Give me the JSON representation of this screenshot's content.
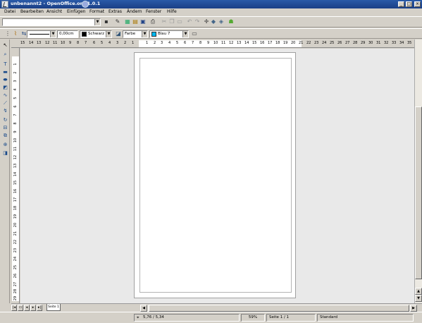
{
  "window": {
    "title": "unbenannt2 - OpenOffice.org 1.0.1",
    "controls": [
      "_",
      "□",
      "×"
    ]
  },
  "menu": [
    "Datei",
    "Bearbeiten",
    "Ansicht",
    "Einfügen",
    "Format",
    "Extras",
    "Ändern",
    "Fenster",
    "Hilfe"
  ],
  "toolbar1": {
    "url_value": ""
  },
  "toolbar2": {
    "line_style": "",
    "line_width": "0,00cm",
    "line_color": "Schwarz",
    "line_color_hex": "#000000",
    "area_style": "Farbe",
    "area_color": "Blau 7",
    "area_color_hex": "#00b8f0"
  },
  "ruler_h": {
    "left": [
      "15",
      "14",
      "13",
      "12",
      "11",
      "10",
      "9",
      "8",
      "7",
      "6",
      "5",
      "4",
      "3",
      "2",
      "1"
    ],
    "right": [
      "1",
      "2",
      "3",
      "4",
      "5",
      "6",
      "7",
      "8",
      "9",
      "10",
      "11",
      "12",
      "13",
      "14",
      "15",
      "16",
      "17",
      "18",
      "19",
      "20",
      "21",
      "22",
      "23",
      "24",
      "25",
      "26",
      "27",
      "28",
      "29",
      "30",
      "31",
      "32",
      "33",
      "34",
      "35"
    ]
  },
  "ruler_v": [
    "1",
    "2",
    "3",
    "4",
    "5",
    "6",
    "7",
    "8",
    "9",
    "10",
    "11",
    "12",
    "13",
    "14",
    "15",
    "16",
    "17",
    "18",
    "19",
    "20",
    "21",
    "22",
    "23",
    "24",
    "25",
    "26",
    "27",
    "28",
    "29"
  ],
  "tabs": {
    "current": "Seite 1"
  },
  "status": {
    "position": "5,76 / 5,34",
    "zoom": "59%",
    "page": "Seite 1 / 1",
    "layout": "Standard"
  }
}
